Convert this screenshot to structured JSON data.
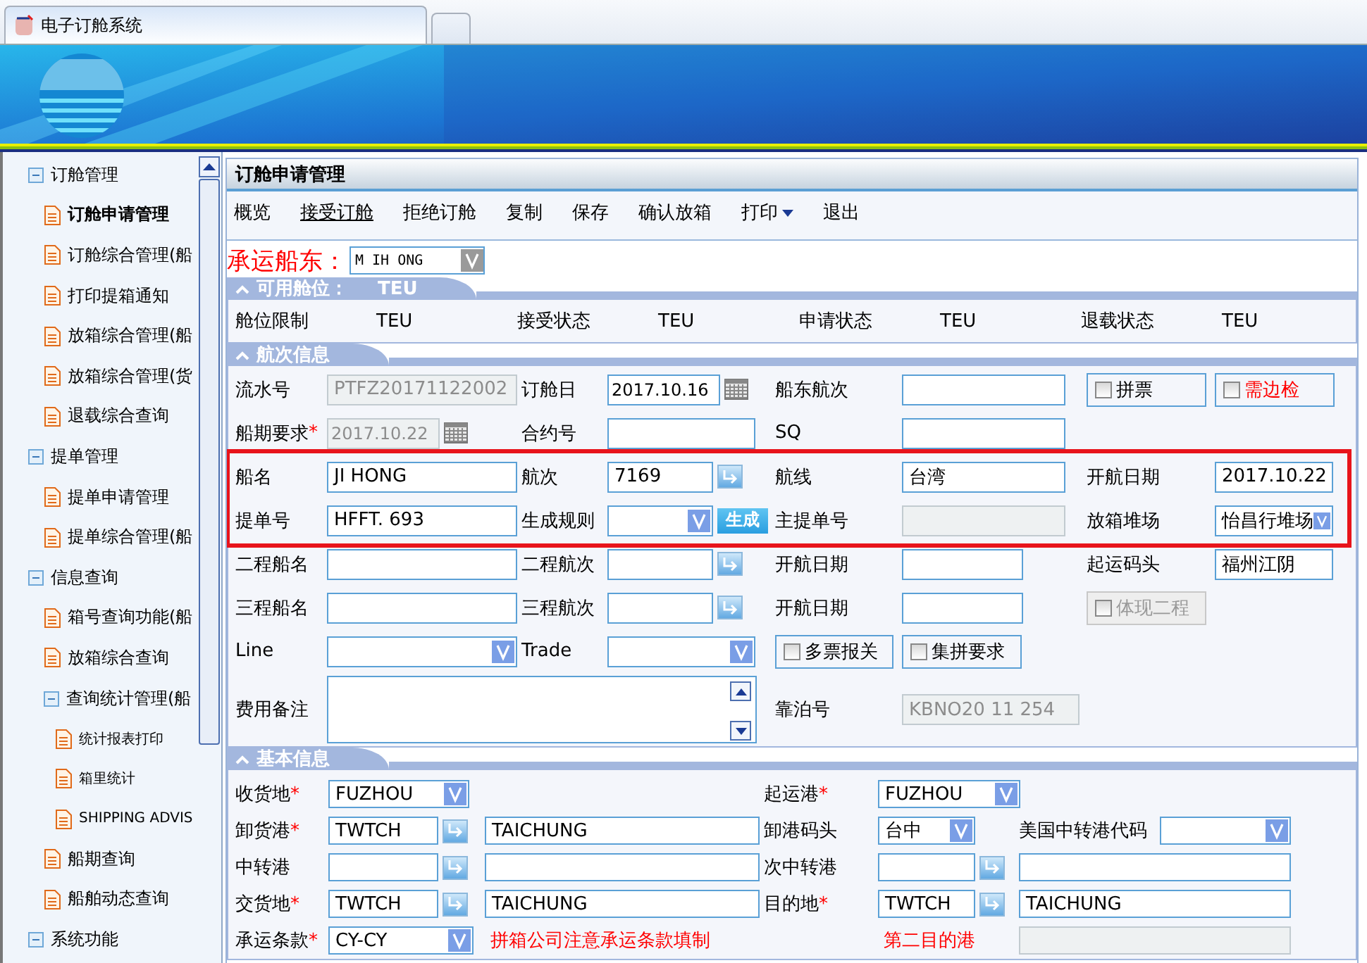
{
  "browser_tabs": [
    {
      "title": "电子订舱系统",
      "selected": true
    },
    {
      "selected": false
    }
  ],
  "sidebar": {
    "items": [
      {
        "label": "订舱管理",
        "expanded": true,
        "children": [
          {
            "label": "订舱申请管理",
            "selected": true
          },
          {
            "label": "订舱综合管理(船",
            "selected": false
          },
          {
            "label": "打印提箱通知",
            "selected": false
          },
          {
            "label": "放箱综合管理(船",
            "selected": false
          },
          {
            "label": "放箱综合管理(货",
            "selected": false
          },
          {
            "label": "退载综合查询",
            "selected": false
          }
        ]
      },
      {
        "label": "提单管理",
        "expanded": true,
        "children": [
          {
            "label": "提单申请管理",
            "selected": false
          },
          {
            "label": "提单综合管理(船",
            "selected": false
          }
        ]
      },
      {
        "label": "信息查询",
        "expanded": true,
        "children": [
          {
            "label": "箱号查询功能(船",
            "selected": false
          },
          {
            "label": "放箱综合查询",
            "selected": false
          },
          {
            "label": "查询统计管理(船",
            "expanded": true,
            "children": [
              {
                "label": "统计报表打印",
                "selected": false
              },
              {
                "label": "箱里统计",
                "selected": false
              },
              {
                "label": "SHIPPING ADVIS",
                "selected": false
              }
            ]
          },
          {
            "label": "船期查询",
            "selected": false
          },
          {
            "label": "船舶动态查询",
            "selected": false
          }
        ]
      },
      {
        "label": "系统功能",
        "expanded": true
      }
    ]
  },
  "page": {
    "title": "订舱申请管理",
    "toolbar": [
      {
        "label": "概览",
        "underlined": false,
        "dropdown": false
      },
      {
        "label": "接受订舱",
        "underlined": true,
        "dropdown": false
      },
      {
        "label": "拒绝订舱",
        "underlined": false,
        "dropdown": false
      },
      {
        "label": "复制",
        "underlined": false,
        "dropdown": false
      },
      {
        "label": "保存",
        "underlined": false,
        "dropdown": false
      },
      {
        "label": "确认放箱",
        "underlined": false,
        "dropdown": false
      },
      {
        "label": "打印",
        "underlined": false,
        "dropdown": true
      },
      {
        "label": "退出",
        "underlined": false,
        "dropdown": false
      }
    ],
    "carrier": {
      "label": "承运船东：",
      "value": "M IH ONG"
    }
  },
  "capacity": {
    "title": "可用舱位：",
    "unit": "TEU",
    "cells": [
      {
        "label": "舱位限制",
        "value": "TEU"
      },
      {
        "label": "接受状态",
        "value": "TEU"
      },
      {
        "label": "申请状态",
        "value": "TEU"
      },
      {
        "label": "退载状态",
        "value": "TEU"
      }
    ]
  },
  "voyage": {
    "title": "航次信息",
    "rows": [
      {
        "highlighted": false,
        "cells": [
          {
            "kind": "label",
            "text": "流水号"
          },
          {
            "kind": "input",
            "value": "PTFZ20171122002",
            "disabled": true
          },
          {
            "kind": "label",
            "text": "订舱日"
          },
          {
            "kind": "date",
            "value": "2017.10.16",
            "disabled": false
          },
          "",
          {
            "kind": "label",
            "text": "船东航次"
          },
          {
            "kind": "input",
            "disabled": false
          },
          {
            "kind": "checkbox",
            "label": "拼票",
            "checked": false,
            "disabled": false,
            "alert": false
          },
          {
            "kind": "checkbox",
            "label": "需边检",
            "checked": false,
            "disabled": false,
            "alert": true
          }
        ]
      },
      {
        "highlighted": false,
        "cells": [
          {
            "kind": "label",
            "text": "船期要求",
            "required_mark": "*"
          },
          {
            "kind": "date",
            "value": "2017.10.22",
            "disabled": true
          },
          {
            "kind": "label",
            "text": "合约号"
          },
          {
            "kind": "input",
            "disabled": false
          },
          "",
          {
            "kind": "label",
            "text": "SQ"
          },
          {
            "kind": "input",
            "disabled": false
          }
        ]
      },
      {
        "highlighted": true,
        "cells": [
          {
            "kind": "label",
            "text": "船名"
          },
          {
            "kind": "input",
            "value": "JI HONG",
            "disabled": false
          },
          {
            "kind": "label",
            "text": "航次"
          },
          {
            "kind": "input",
            "value": "7169",
            "disabled": false
          },
          {
            "kind": "lookup"
          },
          {
            "kind": "label",
            "text": "航线"
          },
          {
            "kind": "input",
            "value": "台湾",
            "disabled": false
          },
          {
            "kind": "label",
            "text": "开航日期"
          },
          {
            "kind": "input",
            "value": "2017.10.22",
            "disabled": false
          }
        ]
      },
      {
        "highlighted": true,
        "cells": [
          {
            "kind": "label",
            "text": "提单号"
          },
          {
            "kind": "input",
            "value": "HFFT. 693",
            "disabled": false
          },
          {
            "kind": "label",
            "text": "生成规则"
          },
          {
            "kind": "select",
            "disabled": false
          },
          {
            "kind": "action",
            "text": "生成"
          },
          {
            "kind": "label",
            "text": "主提单号"
          },
          {
            "kind": "input",
            "disabled": true
          },
          {
            "kind": "label",
            "text": "放箱堆场"
          },
          {
            "kind": "select",
            "value": "怡昌行堆场",
            "disabled": false
          }
        ]
      },
      {
        "highlighted": false,
        "cells": [
          {
            "kind": "label",
            "text": "二程船名"
          },
          {
            "kind": "input",
            "disabled": false
          },
          {
            "kind": "label",
            "text": "二程航次"
          },
          {
            "kind": "input",
            "disabled": false
          },
          {
            "kind": "lookup"
          },
          {
            "kind": "label",
            "text": "开航日期"
          },
          {
            "kind": "input",
            "disabled": false
          },
          {
            "kind": "label",
            "text": "起运码头"
          },
          {
            "kind": "input",
            "value": "福州江阴",
            "disabled": false
          }
        ]
      },
      {
        "highlighted": false,
        "cells": [
          {
            "kind": "label",
            "text": "三程船名"
          },
          {
            "kind": "input",
            "disabled": false
          },
          {
            "kind": "label",
            "text": "三程航次"
          },
          {
            "kind": "input",
            "disabled": false
          },
          {
            "kind": "lookup"
          },
          {
            "kind": "label",
            "text": "开航日期"
          },
          {
            "kind": "input",
            "disabled": false
          },
          {
            "kind": "checkbox",
            "label": "体现二程",
            "checked": false,
            "disabled": true,
            "alert": false
          }
        ]
      },
      {
        "highlighted": false,
        "cells": [
          {
            "kind": "label",
            "text": "Line"
          },
          {
            "kind": "select",
            "disabled": false
          },
          {
            "kind": "label",
            "text": "Trade"
          },
          {
            "kind": "select",
            "disabled": false
          },
          "",
          {
            "kind": "checkbox",
            "label": "多票报关",
            "checked": false,
            "disabled": false,
            "alert": false
          },
          {
            "kind": "checkbox",
            "label": "集拼要求",
            "checked": false,
            "disabled": false,
            "alert": false
          }
        ]
      },
      {
        "highlighted": false,
        "cells": [
          {
            "kind": "label",
            "text": "费用备注"
          },
          {
            "kind": "textarea",
            "disabled": false
          },
          "",
          "",
          "",
          {
            "kind": "label",
            "text": "靠泊号"
          },
          {
            "kind": "input",
            "value": "KBNO20 11 254",
            "disabled": true
          }
        ]
      }
    ]
  },
  "basic": {
    "title": "基本信息",
    "rows": [
      {
        "cells": [
          {
            "kind": "label",
            "text": "收货地",
            "required_mark": "*"
          },
          {
            "kind": "select",
            "value": "FUZHOU",
            "disabled": false
          },
          "",
          "",
          {
            "kind": "label",
            "text": "起运港",
            "required_mark": "*"
          },
          {
            "kind": "select",
            "value": "FUZHOU",
            "disabled": false
          }
        ]
      },
      {
        "cells": [
          {
            "kind": "label",
            "text": "卸货港",
            "required_mark": "*"
          },
          {
            "kind": "input",
            "value": "TWTCH",
            "disabled": false
          },
          {
            "kind": "lookup"
          },
          {
            "kind": "input",
            "value": "TAICHUNG",
            "disabled": false
          },
          {
            "kind": "label",
            "text": "卸港码头"
          },
          {
            "kind": "select",
            "value": "台中",
            "disabled": false
          },
          "",
          {
            "kind": "label",
            "text": "美国中转港代码"
          },
          {
            "kind": "select",
            "disabled": false
          }
        ]
      },
      {
        "cells": [
          {
            "kind": "label",
            "text": "中转港"
          },
          {
            "kind": "input",
            "disabled": false
          },
          {
            "kind": "lookup"
          },
          {
            "kind": "input",
            "disabled": false
          },
          {
            "kind": "label",
            "text": "次中转港"
          },
          {
            "kind": "input",
            "disabled": false
          },
          {
            "kind": "lookup"
          },
          {
            "kind": "input",
            "disabled": false
          }
        ]
      },
      {
        "cells": [
          {
            "kind": "label",
            "text": "交货地",
            "required_mark": "*"
          },
          {
            "kind": "input",
            "value": "TWTCH",
            "disabled": false
          },
          {
            "kind": "lookup"
          },
          {
            "kind": "input",
            "value": "TAICHUNG",
            "disabled": false
          },
          {
            "kind": "label",
            "text": "目的地",
            "required_mark": "*"
          },
          {
            "kind": "input",
            "value": "TWTCH",
            "disabled": false
          },
          {
            "kind": "lookup"
          },
          {
            "kind": "input",
            "value": "TAICHUNG",
            "disabled": false
          }
        ]
      },
      {
        "cells": [
          {
            "kind": "label",
            "text": "承运条款",
            "required_mark": "*"
          },
          {
            "kind": "select",
            "value": "CY-CY",
            "disabled": false
          },
          "",
          {
            "kind": "note",
            "text": "拼箱公司注意承运条款填制"
          },
          "",
          {
            "kind": "note",
            "text": "第二目的港"
          },
          "",
          {
            "kind": "input",
            "disabled": true
          }
        ]
      }
    ]
  }
}
